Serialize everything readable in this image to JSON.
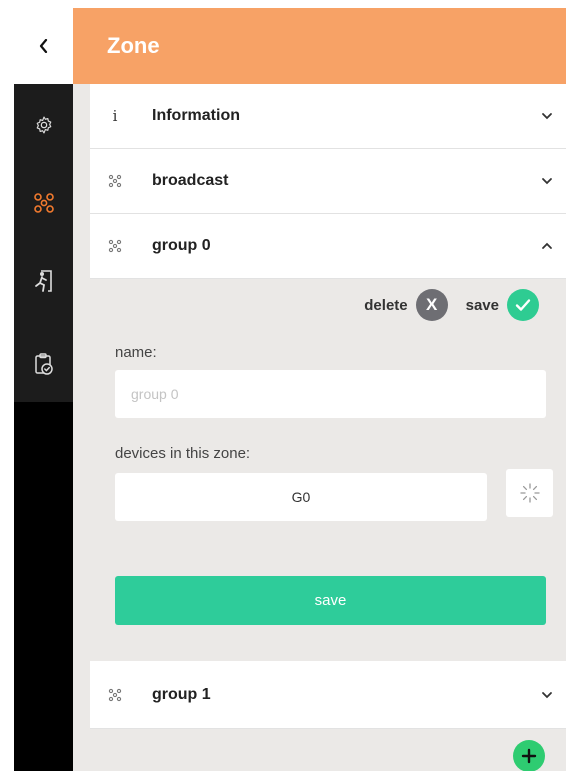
{
  "header": {
    "title": "Zone"
  },
  "nav": {
    "back_icon": "chevron-left-icon",
    "items": [
      {
        "icon": "gear-icon",
        "active": false
      },
      {
        "icon": "zone-network-icon",
        "active": true,
        "color": "#f27a2e"
      },
      {
        "icon": "emergency-exit-icon",
        "active": false
      },
      {
        "icon": "clipboard-check-icon",
        "active": false
      }
    ]
  },
  "accordion": {
    "information": {
      "icon_text": "i",
      "label": "Information"
    },
    "broadcast": {
      "label": "broadcast"
    },
    "group0": {
      "label": "group 0"
    },
    "group1": {
      "label": "group 1"
    }
  },
  "group_panel": {
    "delete_label": "delete",
    "delete_glyph": "X",
    "save_label": "save",
    "name_label": "name:",
    "name_placeholder": "group 0",
    "devices_label": "devices in this zone:",
    "devices_value": "G0",
    "save_button_label": "save"
  },
  "colors": {
    "header": "#f7a266",
    "accent_green": "#2ecc9a",
    "delete_gray": "#6e6e73",
    "active_nav": "#f27a2e"
  }
}
